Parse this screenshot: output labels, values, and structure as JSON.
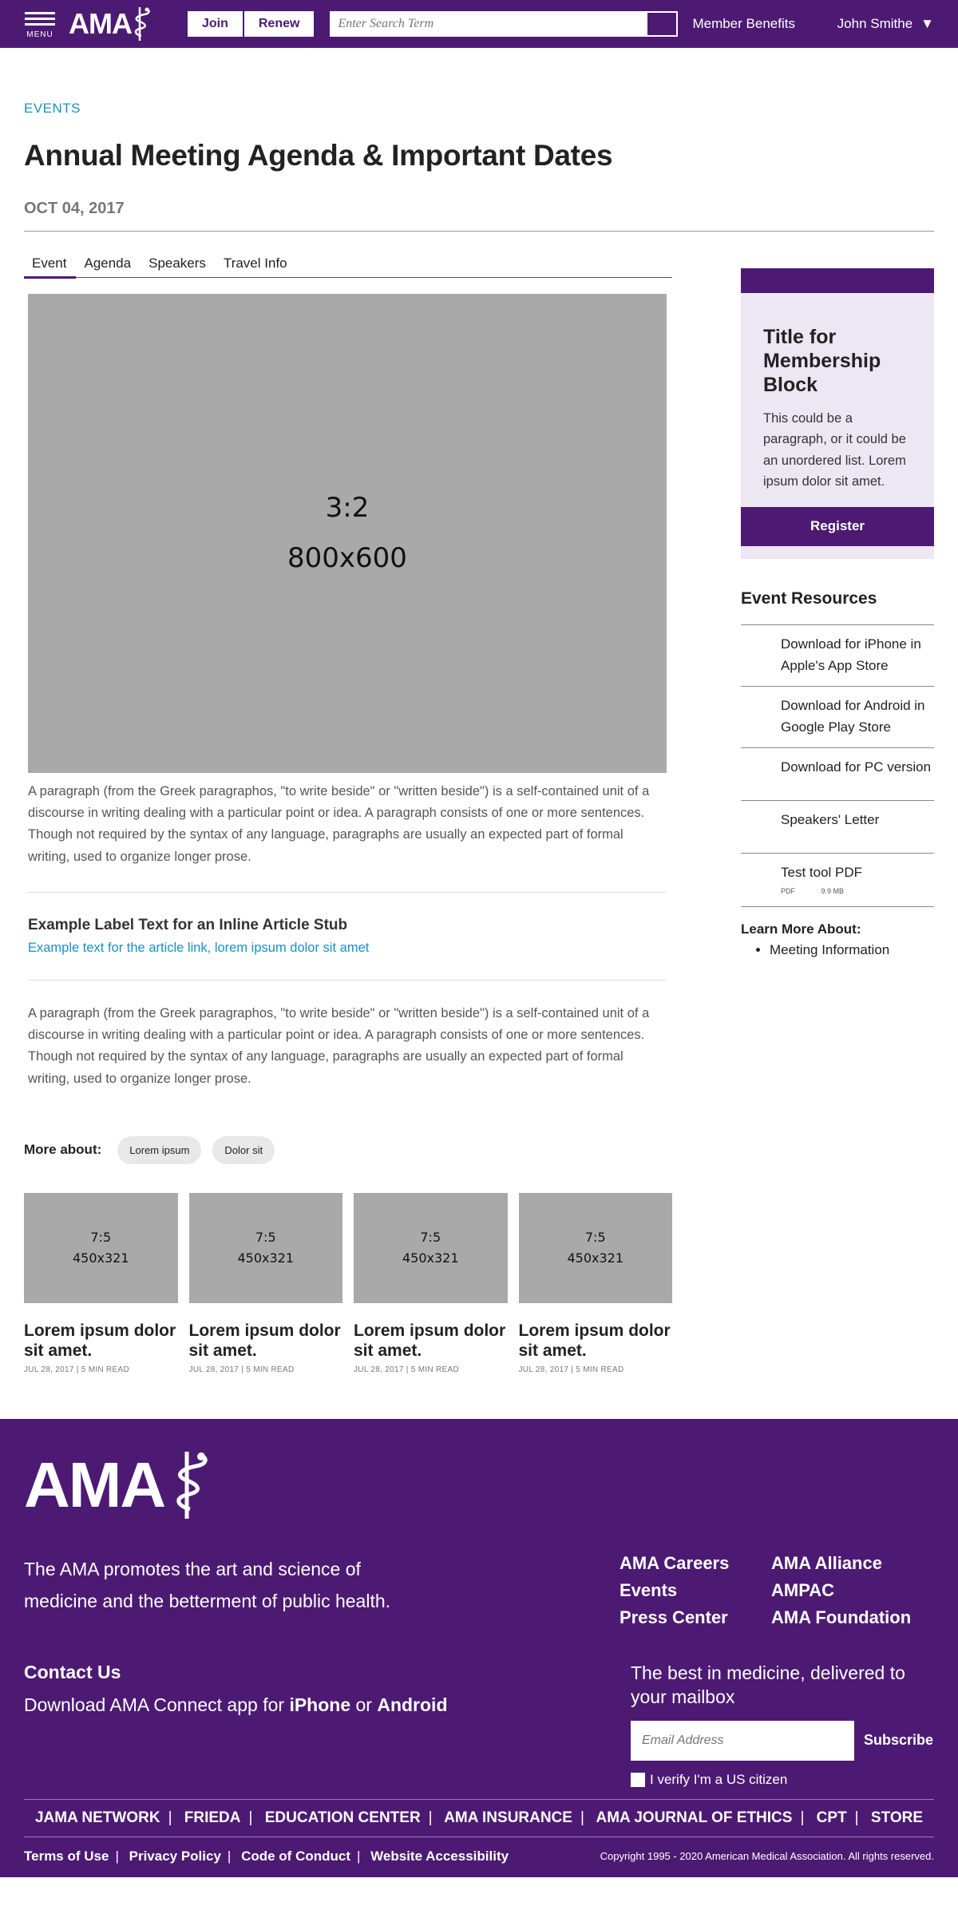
{
  "header": {
    "menu_label": "MENU",
    "logo_text": "AMA",
    "join_label": "Join",
    "renew_label": "Renew",
    "search_placeholder": "Enter Search Term",
    "member_benefits": "Member Benefits",
    "user_name": "John Smithe",
    "brand_color": "#4d1a73"
  },
  "article": {
    "eyebrow": "EVENTS",
    "title": "Annual Meeting Agenda & Important Dates",
    "date": "OCT 04, 2017",
    "tabs": [
      "Event",
      "Agenda",
      "Speakers",
      "Travel Info"
    ],
    "hero_ratio": "3:2",
    "hero_size": "800x600",
    "paragraph_1": "A paragraph (from the Greek paragraphos, \"to write beside\" or \"written beside\") is a self-contained unit of a discourse in writing dealing with a particular point or idea. A paragraph consists of one or more sentences. Though not required by the syntax of any language, paragraphs are usually an expected part of formal writing, used to organize longer prose.",
    "stub_label": "Example Label Text for an Inline Article Stub",
    "stub_link": "Example text for the article link, lorem ipsum dolor sit amet",
    "paragraph_2": "A paragraph (from the Greek paragraphos, \"to write beside\" or \"written beside\") is a self-contained unit of a discourse in writing dealing with a particular point or idea. A paragraph consists of one or more sentences. Though not required by the syntax of any language, paragraphs are usually an expected part of formal writing, used to organize longer prose.",
    "more_about_label": "More about:",
    "tags": [
      "Lorem ipsum",
      "Dolor sit"
    ]
  },
  "cards": [
    {
      "ratio": "7:5",
      "size": "450x321",
      "title": "Lorem ipsum dolor sit amet.",
      "meta": "JUL 28, 2017 | 5 MIN READ"
    },
    {
      "ratio": "7:5",
      "size": "450x321",
      "title": "Lorem ipsum dolor sit amet.",
      "meta": "JUL 28, 2017 | 5 MIN READ"
    },
    {
      "ratio": "7:5",
      "size": "450x321",
      "title": "Lorem ipsum dolor sit amet.",
      "meta": "JUL 28, 2017 | 5 MIN READ"
    },
    {
      "ratio": "7:5",
      "size": "450x321",
      "title": "Lorem ipsum dolor sit amet.",
      "meta": "JUL 28, 2017 | 5 MIN READ"
    }
  ],
  "sidebar": {
    "membership": {
      "title": "Title for Membership Block",
      "text": "This could be a paragraph, or it could be an unordered list. Lorem ipsum dolor sit amet.",
      "button": "Register"
    },
    "resources_title": "Event Resources",
    "resources": [
      {
        "label": "Download for iPhone in Apple's App Store"
      },
      {
        "label": "Download for Android in Google Play Store"
      },
      {
        "label": "Download for PC version"
      },
      {
        "label": "Speakers' Letter"
      },
      {
        "label": "Test tool PDF",
        "type": "PDF",
        "size": "9.9 MB"
      }
    ],
    "learn_title": "Learn More About:",
    "learn_items": [
      "Meeting Information"
    ]
  },
  "footer": {
    "logo_text": "AMA",
    "mission": "The AMA promotes the art and science of medicine and the betterment of public health.",
    "links": [
      "AMA Careers",
      "AMA Alliance",
      "Events",
      "AMPAC",
      "Press Center",
      "AMA Foundation"
    ],
    "contact_title": "Contact Us",
    "contact_prefix": "Download AMA Connect app for",
    "contact_iphone": "iPhone",
    "contact_or": "or",
    "contact_android": "Android",
    "mail_title": "The best in medicine, delivered to your mailbox",
    "email_placeholder": "Email Address",
    "subscribe": "Subscribe",
    "verify": "I verify I'm a US citizen",
    "nav": [
      "JAMA NETWORK",
      "FRIEDA",
      "EDUCATION CENTER",
      "AMA INSURANCE",
      "AMA JOURNAL OF ETHICS",
      "CPT",
      "STORE"
    ],
    "legal": [
      "Terms of Use",
      "Privacy Policy",
      "Code of Conduct",
      "Website Accessibility"
    ],
    "copyright": "Copyright 1995 - 2020 American Medical Association. All rights reserved."
  }
}
